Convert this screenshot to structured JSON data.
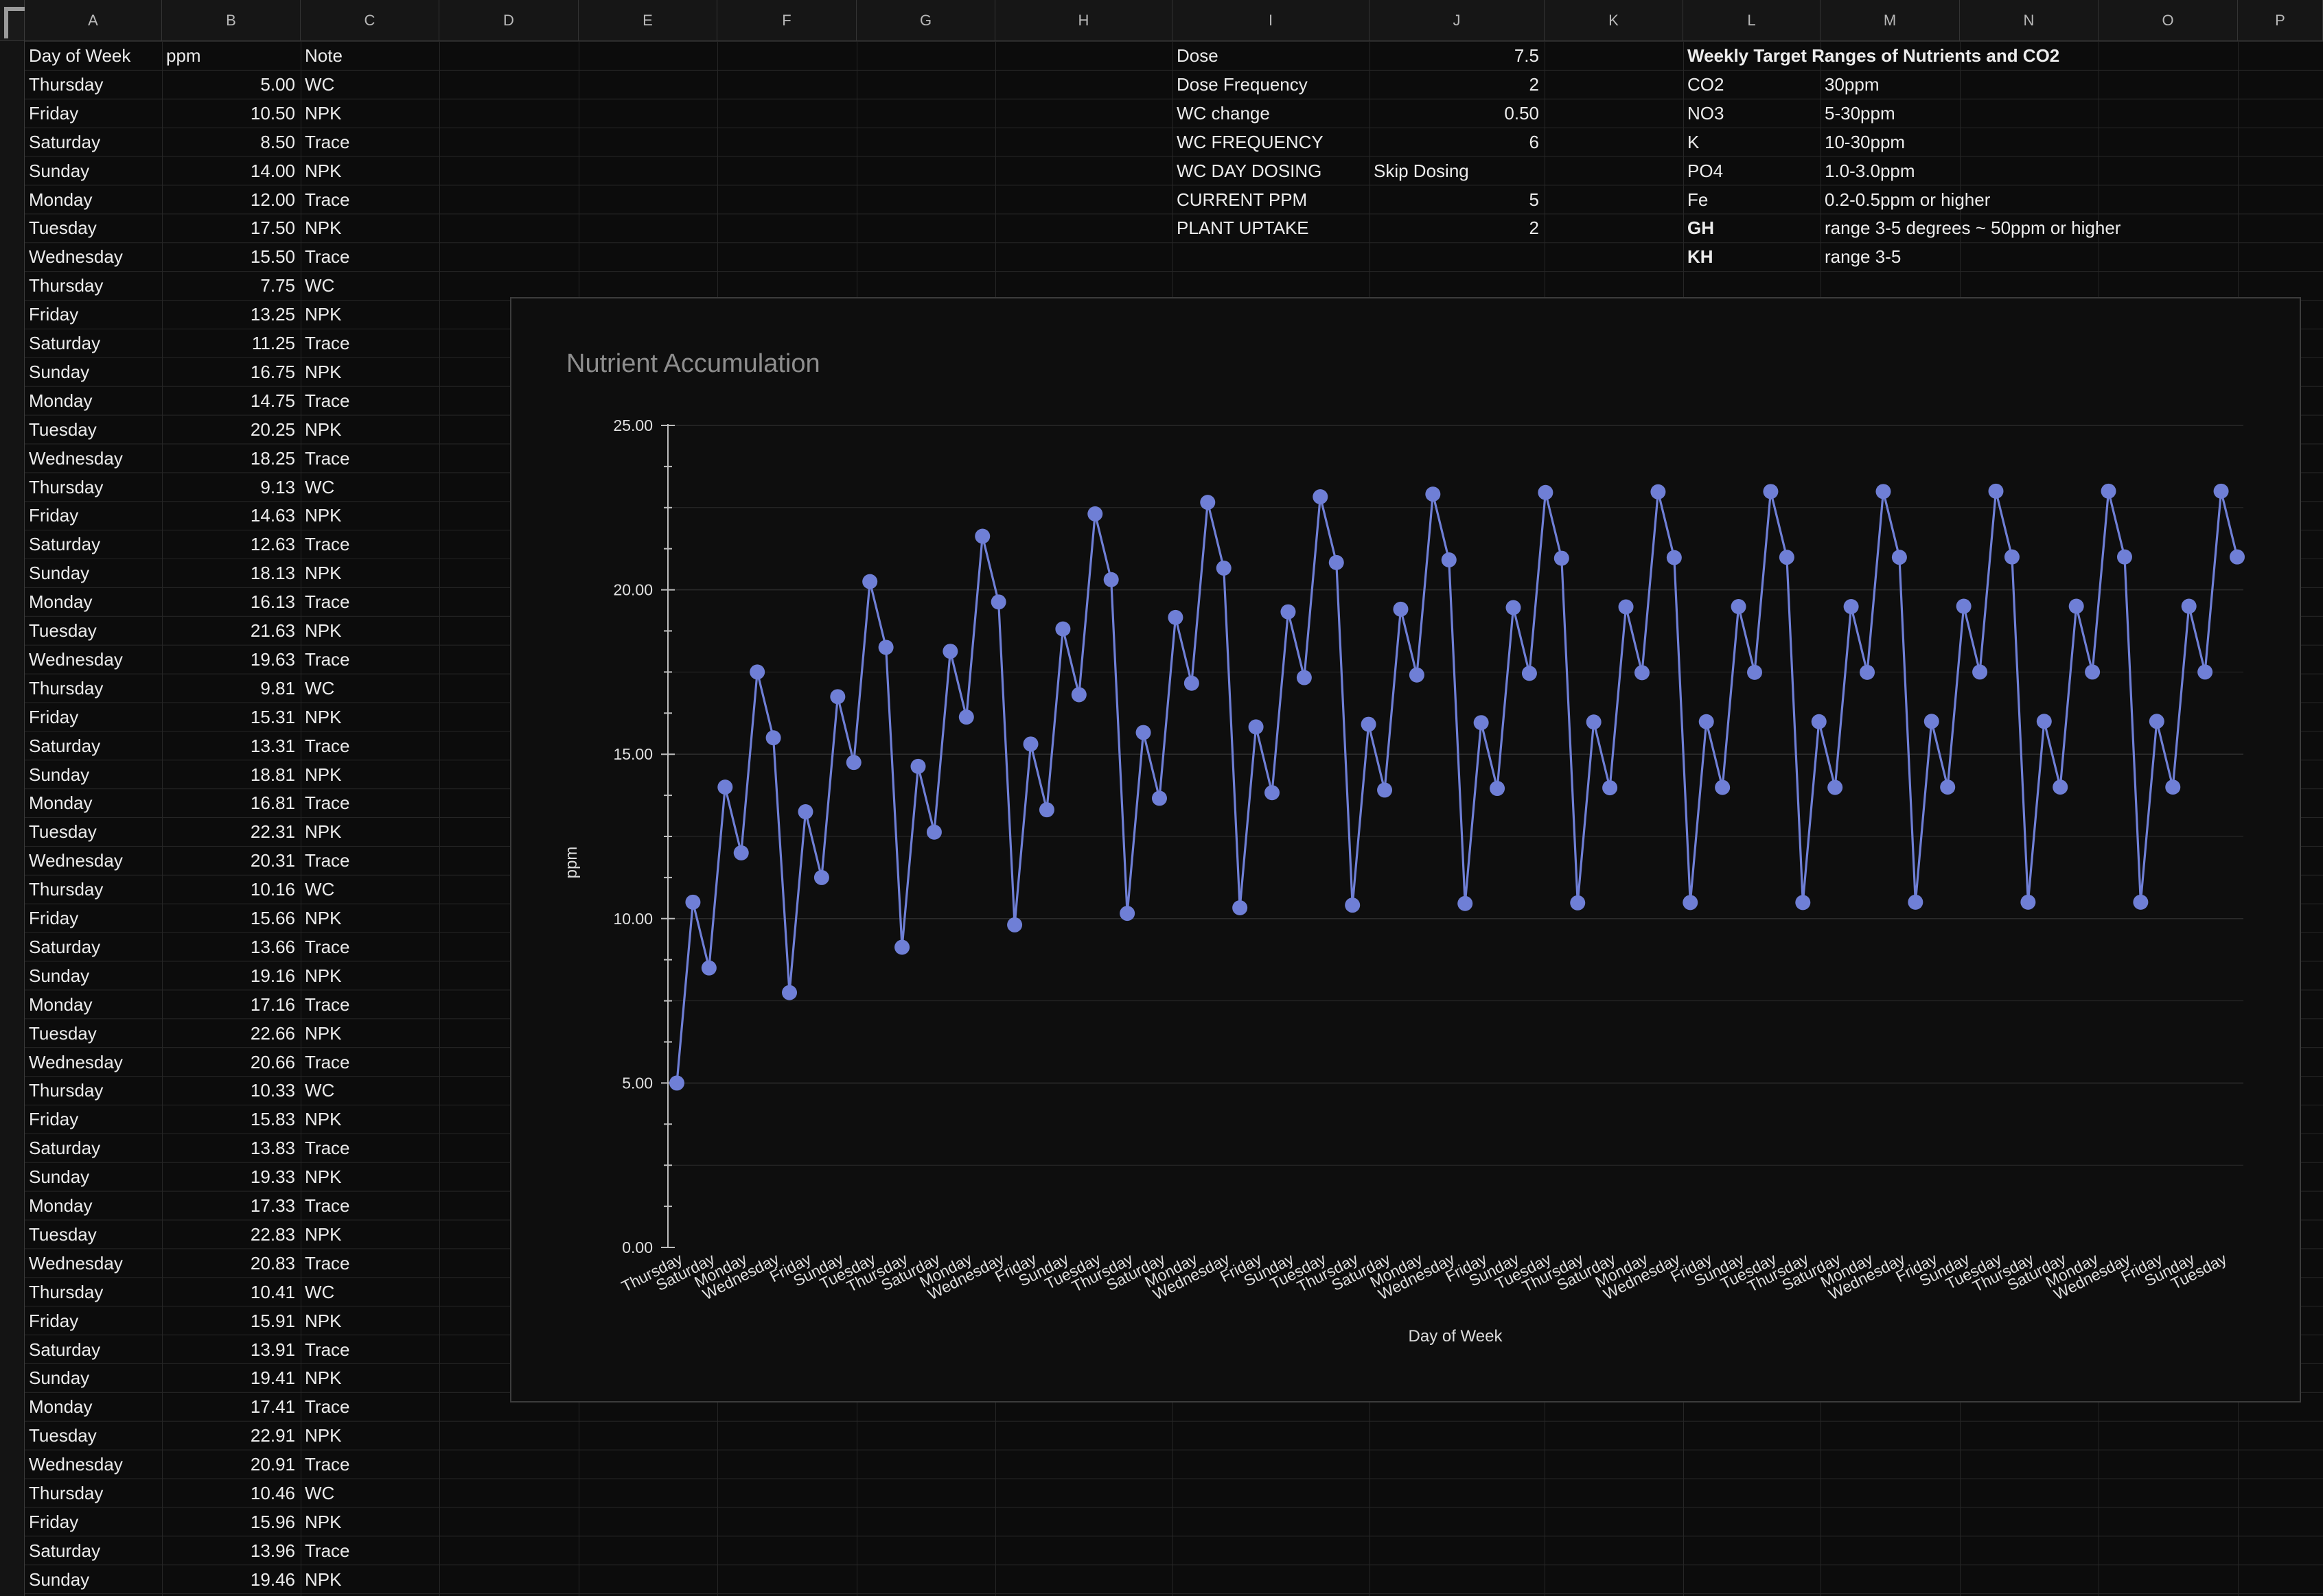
{
  "columns": [
    "A",
    "B",
    "C",
    "D",
    "E",
    "F",
    "G",
    "H",
    "I",
    "J",
    "K",
    "L",
    "M",
    "N",
    "O",
    "P"
  ],
  "table": {
    "headers": [
      "Day of Week",
      "ppm",
      "Note"
    ],
    "rows": [
      [
        "Thursday",
        "5.00",
        "WC"
      ],
      [
        "Friday",
        "10.50",
        "NPK"
      ],
      [
        "Saturday",
        "8.50",
        "Trace"
      ],
      [
        "Sunday",
        "14.00",
        "NPK"
      ],
      [
        "Monday",
        "12.00",
        "Trace"
      ],
      [
        "Tuesday",
        "17.50",
        "NPK"
      ],
      [
        "Wednesday",
        "15.50",
        "Trace"
      ],
      [
        "Thursday",
        "7.75",
        "WC"
      ],
      [
        "Friday",
        "13.25",
        "NPK"
      ],
      [
        "Saturday",
        "11.25",
        "Trace"
      ],
      [
        "Sunday",
        "16.75",
        "NPK"
      ],
      [
        "Monday",
        "14.75",
        "Trace"
      ],
      [
        "Tuesday",
        "20.25",
        "NPK"
      ],
      [
        "Wednesday",
        "18.25",
        "Trace"
      ],
      [
        "Thursday",
        "9.13",
        "WC"
      ],
      [
        "Friday",
        "14.63",
        "NPK"
      ],
      [
        "Saturday",
        "12.63",
        "Trace"
      ],
      [
        "Sunday",
        "18.13",
        "NPK"
      ],
      [
        "Monday",
        "16.13",
        "Trace"
      ],
      [
        "Tuesday",
        "21.63",
        "NPK"
      ],
      [
        "Wednesday",
        "19.63",
        "Trace"
      ],
      [
        "Thursday",
        "9.81",
        "WC"
      ],
      [
        "Friday",
        "15.31",
        "NPK"
      ],
      [
        "Saturday",
        "13.31",
        "Trace"
      ],
      [
        "Sunday",
        "18.81",
        "NPK"
      ],
      [
        "Monday",
        "16.81",
        "Trace"
      ],
      [
        "Tuesday",
        "22.31",
        "NPK"
      ],
      [
        "Wednesday",
        "20.31",
        "Trace"
      ],
      [
        "Thursday",
        "10.16",
        "WC"
      ],
      [
        "Friday",
        "15.66",
        "NPK"
      ],
      [
        "Saturday",
        "13.66",
        "Trace"
      ],
      [
        "Sunday",
        "19.16",
        "NPK"
      ],
      [
        "Monday",
        "17.16",
        "Trace"
      ],
      [
        "Tuesday",
        "22.66",
        "NPK"
      ],
      [
        "Wednesday",
        "20.66",
        "Trace"
      ],
      [
        "Thursday",
        "10.33",
        "WC"
      ],
      [
        "Friday",
        "15.83",
        "NPK"
      ],
      [
        "Saturday",
        "13.83",
        "Trace"
      ],
      [
        "Sunday",
        "19.33",
        "NPK"
      ],
      [
        "Monday",
        "17.33",
        "Trace"
      ],
      [
        "Tuesday",
        "22.83",
        "NPK"
      ],
      [
        "Wednesday",
        "20.83",
        "Trace"
      ],
      [
        "Thursday",
        "10.41",
        "WC"
      ],
      [
        "Friday",
        "15.91",
        "NPK"
      ],
      [
        "Saturday",
        "13.91",
        "Trace"
      ],
      [
        "Sunday",
        "19.41",
        "NPK"
      ],
      [
        "Monday",
        "17.41",
        "Trace"
      ],
      [
        "Tuesday",
        "22.91",
        "NPK"
      ],
      [
        "Wednesday",
        "20.91",
        "Trace"
      ],
      [
        "Thursday",
        "10.46",
        "WC"
      ],
      [
        "Friday",
        "15.96",
        "NPK"
      ],
      [
        "Saturday",
        "13.96",
        "Trace"
      ],
      [
        "Sunday",
        "19.46",
        "NPK"
      ]
    ]
  },
  "params": [
    [
      "Dose",
      "",
      "7.5"
    ],
    [
      "Dose Frequency",
      "",
      "2"
    ],
    [
      "WC change",
      "",
      "0.50"
    ],
    [
      "WC FREQUENCY",
      "",
      "6"
    ],
    [
      "WC DAY DOSING",
      "Skip Dosing",
      ""
    ],
    [
      "CURRENT PPM",
      "",
      "5"
    ],
    [
      "PLANT UPTAKE",
      "",
      "2"
    ]
  ],
  "targets": {
    "title": "Weekly Target Ranges of Nutrients and CO2",
    "rows": [
      [
        "CO2",
        "30ppm",
        false
      ],
      [
        "NO3",
        "5-30ppm",
        false
      ],
      [
        "K",
        "10-30ppm",
        false
      ],
      [
        "PO4",
        "1.0-3.0ppm",
        false
      ],
      [
        "Fe",
        "0.2-0.5ppm or higher",
        false
      ],
      [
        "GH",
        "range 3-5 degrees ~ 50ppm or higher",
        true
      ],
      [
        "KH",
        "range 3-5",
        true
      ]
    ]
  },
  "colors": {
    "series": "#6f7fd6",
    "background": "#0c0c0c",
    "grid": "#262626"
  },
  "chart_data": {
    "type": "line",
    "title": "Nutrient Accumulation",
    "xlabel": "Day of Week",
    "ylabel": "ppm",
    "ylim": [
      0,
      25
    ],
    "yticks": [
      "0.00",
      "5.00",
      "10.00",
      "15.00",
      "20.00",
      "25.00"
    ],
    "x": [
      "Thursday",
      "Friday",
      "Saturday",
      "Sunday",
      "Monday",
      "Tuesday",
      "Wednesday",
      "Thursday",
      "Friday",
      "Saturday",
      "Sunday",
      "Monday",
      "Tuesday",
      "Wednesday",
      "Thursday",
      "Friday",
      "Saturday",
      "Sunday",
      "Monday",
      "Tuesday",
      "Wednesday",
      "Thursday",
      "Friday",
      "Saturday",
      "Sunday",
      "Monday",
      "Tuesday",
      "Wednesday",
      "Thursday",
      "Friday",
      "Saturday",
      "Sunday",
      "Monday",
      "Tuesday",
      "Wednesday",
      "Thursday",
      "Friday",
      "Saturday",
      "Sunday",
      "Monday",
      "Tuesday",
      "Wednesday",
      "Thursday",
      "Friday",
      "Saturday",
      "Sunday",
      "Monday",
      "Tuesday",
      "Wednesday",
      "Thursday",
      "Friday",
      "Saturday",
      "Sunday",
      "Monday",
      "Tuesday",
      "Wednesday",
      "Thursday",
      "Friday",
      "Saturday",
      "Sunday",
      "Monday",
      "Tuesday",
      "Wednesday",
      "Thursday",
      "Friday",
      "Saturday",
      "Sunday",
      "Monday",
      "Tuesday",
      "Wednesday",
      "Thursday",
      "Friday",
      "Saturday",
      "Sunday",
      "Monday",
      "Tuesday",
      "Wednesday",
      "Thursday",
      "Friday",
      "Saturday",
      "Sunday",
      "Monday",
      "Tuesday",
      "Wednesday",
      "Thursday",
      "Friday",
      "Saturday",
      "Sunday",
      "Monday",
      "Tuesday",
      "Wednesday",
      "Thursday",
      "Friday",
      "Saturday",
      "Sunday",
      "Monday",
      "Tuesday",
      "Wednesday"
    ],
    "series": [
      {
        "values": [
          5.0,
          10.5,
          8.5,
          14.0,
          12.0,
          17.5,
          15.5,
          7.75,
          13.25,
          11.25,
          16.75,
          14.75,
          20.25,
          18.25,
          9.13,
          14.63,
          12.63,
          18.13,
          16.13,
          21.63,
          19.63,
          9.81,
          15.31,
          13.31,
          18.81,
          16.81,
          22.31,
          20.31,
          10.16,
          15.66,
          13.66,
          19.16,
          17.16,
          22.66,
          20.66,
          10.33,
          15.83,
          13.83,
          19.33,
          17.33,
          22.83,
          20.83,
          10.41,
          15.91,
          13.91,
          19.41,
          17.41,
          22.91,
          20.91,
          10.46,
          15.96,
          13.96,
          19.46,
          17.46,
          22.96,
          20.96,
          10.48,
          15.98,
          13.98,
          19.48,
          17.48,
          22.98,
          20.98,
          10.49,
          15.99,
          13.99,
          19.49,
          17.49,
          22.99,
          20.99,
          10.49,
          15.99,
          13.99,
          19.49,
          17.49,
          22.99,
          20.99,
          10.5,
          16.0,
          14.0,
          19.5,
          17.5,
          23.0,
          21.0,
          10.5,
          16.0,
          14.0,
          19.5,
          17.5,
          23.0,
          21.0,
          10.5,
          16.0,
          14.0,
          19.5,
          17.5,
          23.0,
          21.0
        ]
      }
    ],
    "grid": true,
    "legend": "none"
  }
}
